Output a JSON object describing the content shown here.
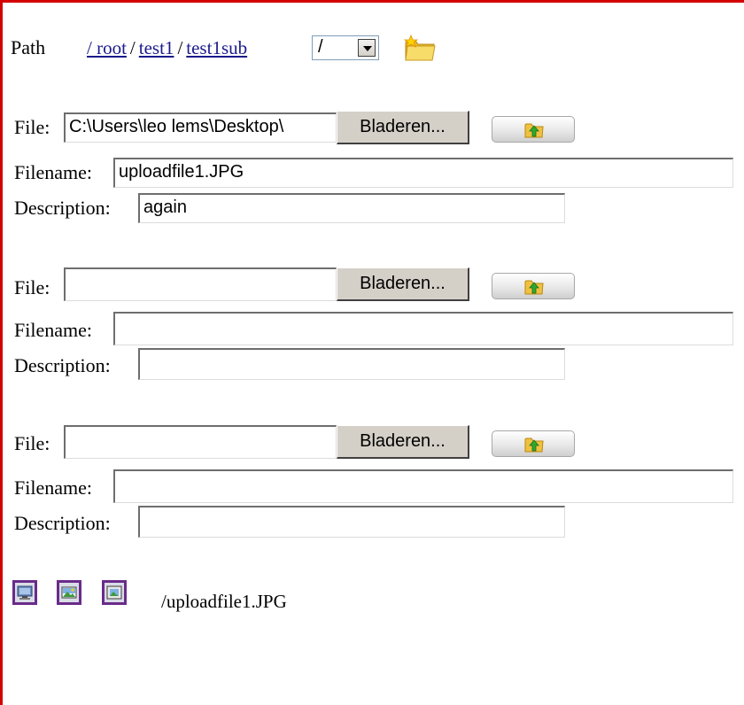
{
  "path": {
    "label": "Path",
    "crumbs": [
      "/ root",
      "test1",
      "test1sub"
    ],
    "separator": "/",
    "select_value": "/",
    "new_folder_icon": "new-folder-icon"
  },
  "upload_rows": [
    {
      "file_label": "File:",
      "file_value": "C:\\Users\\leo lems\\Desktop\\",
      "browse_label": "Bladeren...",
      "filename_label": "Filename:",
      "filename_value": "uploadfile1.JPG",
      "description_label": "Description:",
      "description_value": "again"
    },
    {
      "file_label": "File:",
      "file_value": "",
      "browse_label": "Bladeren...",
      "filename_label": "Filename:",
      "filename_value": "",
      "description_label": "Description:",
      "description_value": ""
    },
    {
      "file_label": "File:",
      "file_value": "",
      "browse_label": "Bladeren...",
      "filename_label": "Filename:",
      "filename_value": "",
      "description_label": "Description:",
      "description_value": ""
    }
  ],
  "upload_button_icon": "upload-folder-icon",
  "footer": {
    "icons": [
      "monitor-icon",
      "image-icon",
      "image-frame-icon"
    ],
    "file_path": "/uploadfile1.JPG"
  },
  "colors": {
    "border_accent": "#d40000",
    "link": "#1a1a8c",
    "tool_border": "#6a2b8a"
  }
}
